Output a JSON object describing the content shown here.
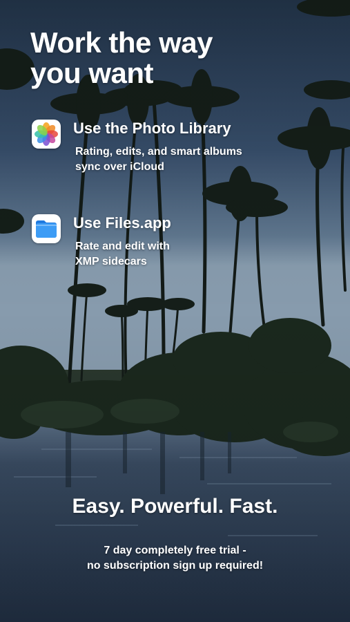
{
  "headline": {
    "line1": "Work the way",
    "line2": "you want"
  },
  "features": [
    {
      "icon": "photos-app-icon",
      "title": "Use the Photo Library",
      "desc_line1": "Rating, edits, and smart albums",
      "desc_line2": "sync over iCloud"
    },
    {
      "icon": "files-app-icon",
      "title": "Use Files.app",
      "desc_line1": "Rate and edit with",
      "desc_line2": "XMP sidecars"
    }
  ],
  "tagline": "Easy. Powerful. Fast.",
  "trial": {
    "line1": "7 day completely free trial -",
    "line2": "no subscription sign up required!"
  },
  "colors": {
    "sky_top": "#2b3f5c",
    "sky_bottom": "#8aa0b6",
    "foliage": "#1e2b20",
    "water": "#2c3d52",
    "text": "#ffffff",
    "files_blue": "#2e8cf0"
  }
}
